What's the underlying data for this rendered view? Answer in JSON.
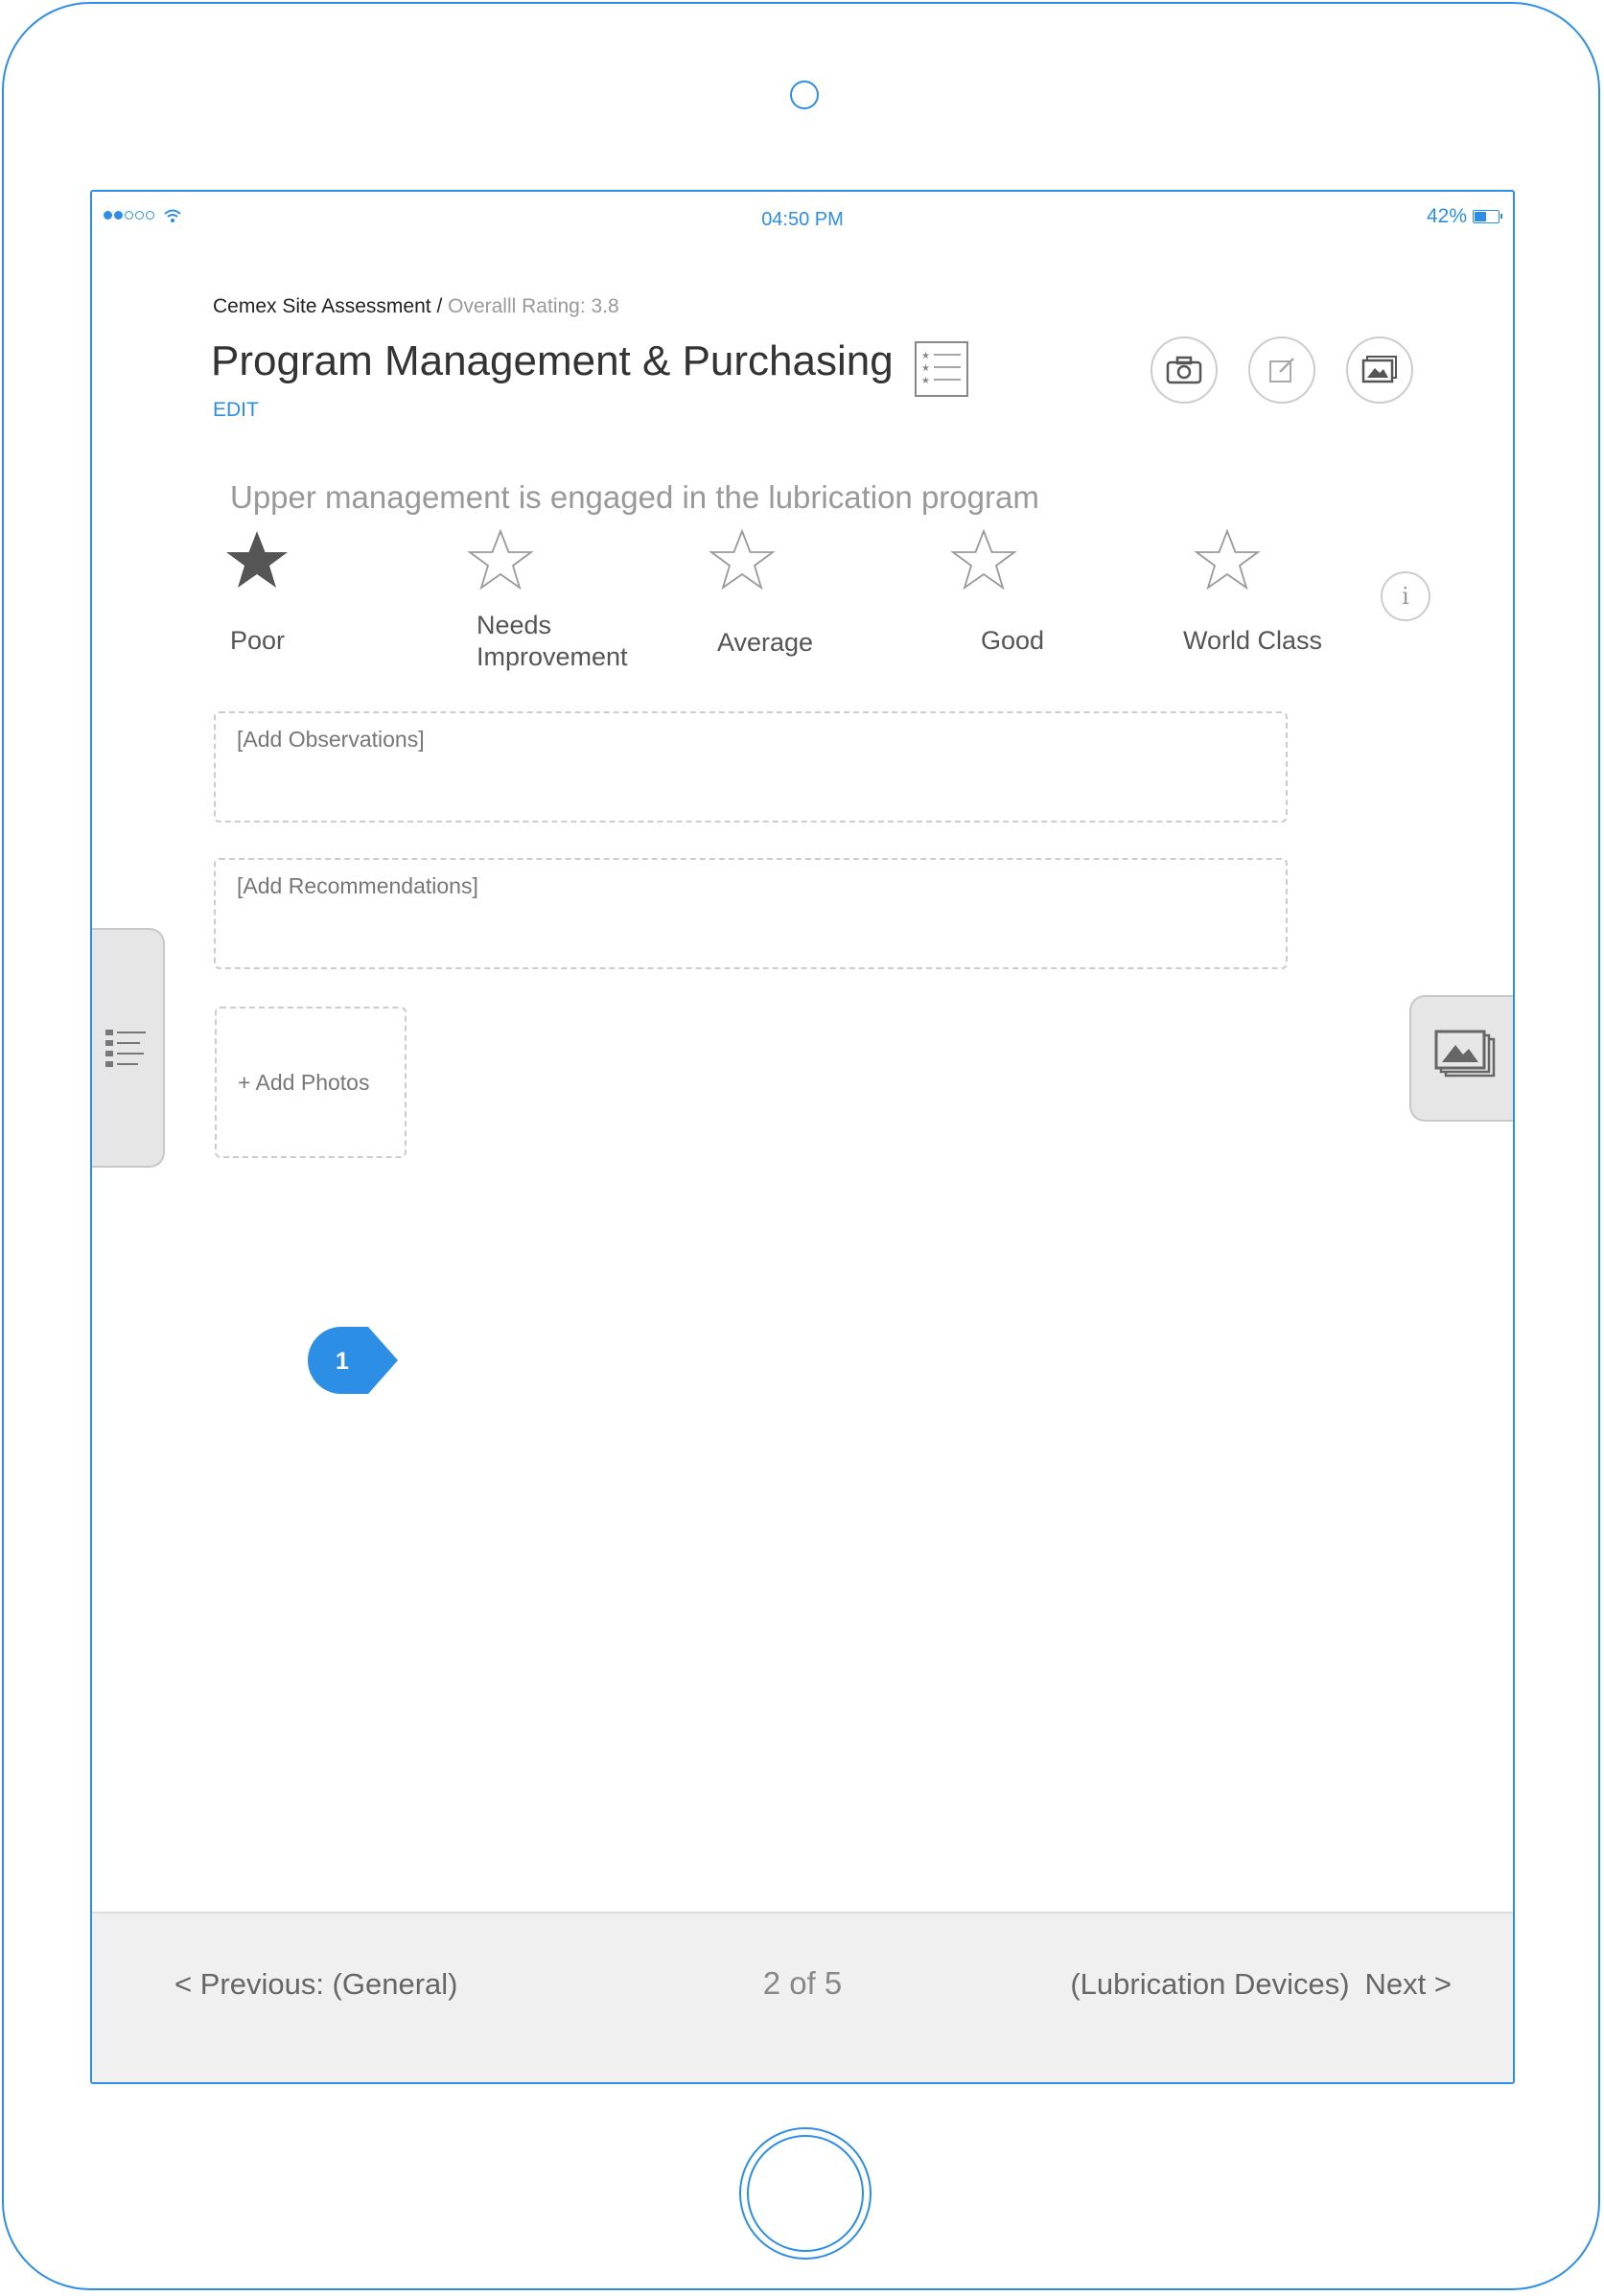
{
  "status_bar": {
    "time": "04:50 PM",
    "battery": "42%",
    "signal_bars_on": 2,
    "signal_bars_total": 5
  },
  "header": {
    "assessment": "Cemex Site Assessment",
    "separator": "/",
    "rating": "Overalll Rating: 3.8",
    "title": "Program Management & Purchasing",
    "edit_label": "EDIT"
  },
  "question": {
    "text": "Upper management is engaged in the lubrication program",
    "options": [
      {
        "label": "Poor",
        "selected": true
      },
      {
        "label": "Needs Improvement",
        "label_lines": [
          "Needs",
          "Improvement"
        ],
        "selected": false
      },
      {
        "label": "Average",
        "selected": false
      },
      {
        "label": "Good",
        "selected": false
      },
      {
        "label": "World Class",
        "selected": false
      }
    ],
    "info_glyph": "i"
  },
  "observations": {
    "placeholder": "[Add Observations]"
  },
  "recommendations": {
    "placeholder": "[Add Recommendations]"
  },
  "photos": {
    "add_label": "+ Add Photos"
  },
  "callout": {
    "number": "1"
  },
  "footer": {
    "previous": "< Previous: (General)",
    "page_count": "2 of 5",
    "next_destination": "(Lubrication Devices)",
    "next": "Next >"
  },
  "icons": [
    "camera-icon",
    "edit-icon",
    "gallery-icon",
    "checklist-icon",
    "info-icon",
    "list-icon",
    "photos-icon",
    "wifi-icon",
    "battery-icon",
    "star-icon"
  ],
  "colors": {
    "accent": "#2d8ee6",
    "star_selected": "#555555",
    "star_empty": "#999999",
    "footer_bg": "#f0f0f0"
  }
}
